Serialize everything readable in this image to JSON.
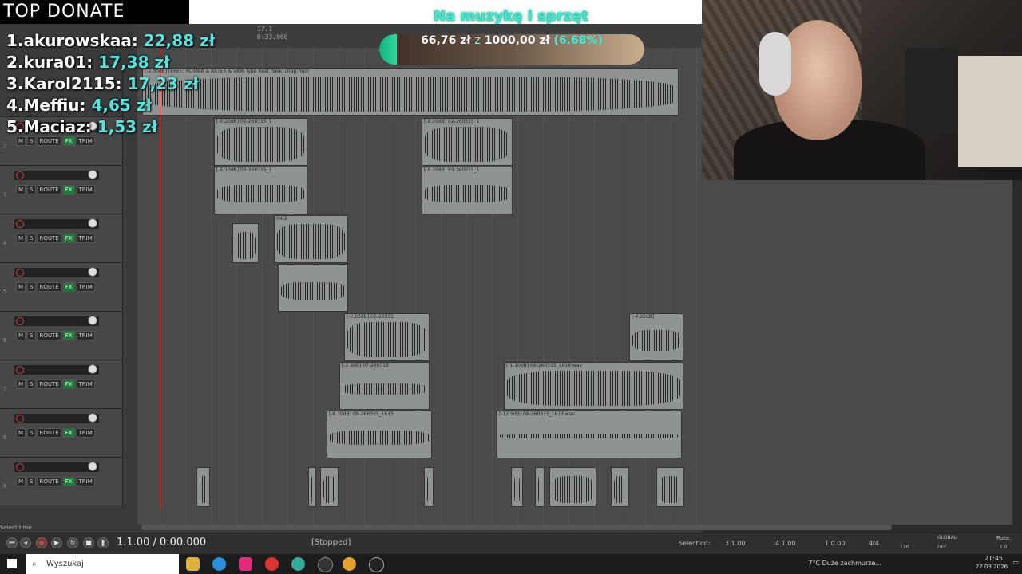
{
  "overlay": {
    "top_donate_title": "TOP DONATE",
    "donors": [
      {
        "name": "1.akurowskaa:",
        "amount": "22,88 zł"
      },
      {
        "name": "2.kura01:",
        "amount": "17,38 zł"
      },
      {
        "name": "3.Karol2115:",
        "amount": "17,23 zł"
      },
      {
        "name": "4.Meffiu:",
        "amount": "4,65 zł"
      },
      {
        "name": "5.Maciaz:",
        "amount": "1,53 zł"
      }
    ],
    "goal": {
      "title": "Na muzykę i sprzęt",
      "current": "66,76 zł",
      "separator": "z",
      "target": "1000,00 zł",
      "percent_label": "(6.68%)",
      "progress_fraction": 0.0668
    }
  },
  "daw": {
    "ruler_ticks": [
      "17.1",
      "0:33.000"
    ],
    "track_numbers": [
      "2",
      "3",
      "4",
      "5",
      "6",
      "7",
      "8",
      "9"
    ],
    "track_buttons": [
      "M",
      "S",
      "ROUTE",
      "FX",
      "TRIM"
    ],
    "item_labels": [
      "[-2.00dB] [FREE] RUSNIA & ASTER & VKIE Type Beat 'Selki Drag.mp3",
      "[-0.20dB] 02-260315_1",
      "[-5.10dB] 03-260315_1",
      "[-0.20dB] 02-260315_1",
      "[-5.20dB] 03-260315_1",
      "04-2",
      "[-0.60dB] 06-26031",
      "[-2.9dB] 07-260315",
      "[-1.10dB] 08-260315_1616.wav",
      "[-8.70dB] 08-260315_1615",
      "[-12.5dB] 08-260315_1617.wav",
      "[-4.20dB]"
    ],
    "status_left": "Select time"
  },
  "transport": {
    "position": "1.1.00 / 0:00.000",
    "state": "[Stopped]",
    "selection_label": "Selection:",
    "selection_start": "3.1.00",
    "selection_end": "4.1.00",
    "selection_length": "1.0.00",
    "time_sig": "4/4",
    "bpm": "120",
    "rate_label": "Rate:",
    "rate_value": "1.0",
    "global_label": "GLOBAL",
    "global_state": "OFF"
  },
  "taskbar": {
    "search_placeholder": "Wyszukaj",
    "weather": "7°C  Duże zachmurze...",
    "time": "21:45",
    "date": "22.03.2026"
  }
}
